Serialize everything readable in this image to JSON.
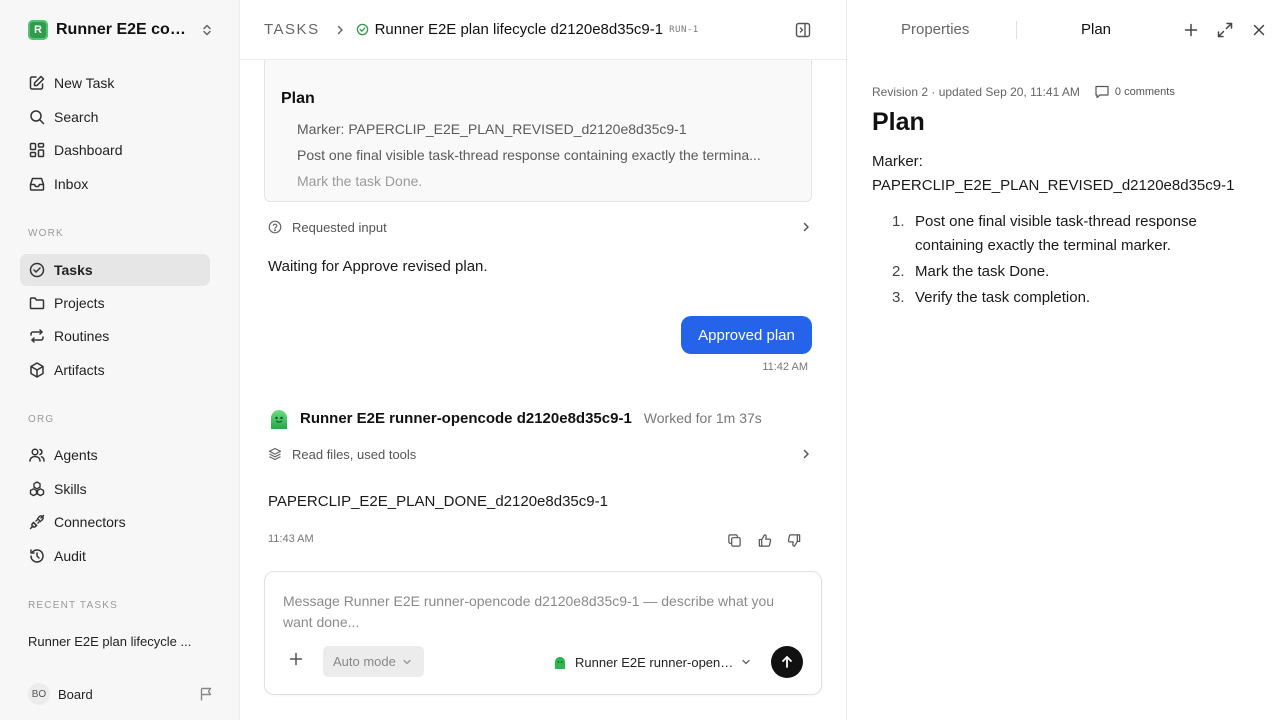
{
  "workspace": {
    "logo_letter": "R",
    "name": "Runner E2E core-..."
  },
  "nav": {
    "new_task": "New Task",
    "search": "Search",
    "dashboard": "Dashboard",
    "inbox": "Inbox",
    "work_label": "WORK",
    "tasks": "Tasks",
    "projects": "Projects",
    "routines": "Routines",
    "artifacts": "Artifacts",
    "org_label": "ORG",
    "agents": "Agents",
    "skills": "Skills",
    "connectors": "Connectors",
    "audit": "Audit",
    "recent_label": "RECENT TASKS",
    "recent_task": "Runner E2E plan lifecycle ..."
  },
  "user": {
    "initials": "BO",
    "name": "Board"
  },
  "header": {
    "breadcrumb_root": "TASKS",
    "task_title": "Runner E2E plan lifecycle d2120e8d35c9-1",
    "run_badge": "RUN-1"
  },
  "plan_card": {
    "title": "Plan",
    "items": [
      "Marker: PAPERCLIP_E2E_PLAN_REVISED_d2120e8d35c9-1",
      "Post one final visible task-thread response containing exactly the termina...",
      "Mark the task Done."
    ]
  },
  "thread": {
    "requested_input": "Requested input",
    "waiting_text": "Waiting for Approve revised plan.",
    "approved_label": "Approved plan",
    "approved_time": "11:42 AM",
    "agent_name": "Runner E2E runner-opencode d2120e8d35c9-1",
    "worked_for": "Worked for 1m 37s",
    "tools_summary": "Read files, used tools",
    "done_marker": "PAPERCLIP_E2E_PLAN_DONE_d2120e8d35c9-1",
    "done_time": "11:43 AM"
  },
  "composer": {
    "placeholder": "Message Runner E2E runner-opencode d2120e8d35c9-1 — describe what you want done...",
    "mode": "Auto mode",
    "agent": "Runner E2E runner-openc..."
  },
  "right_panel": {
    "tab_properties": "Properties",
    "tab_plan": "Plan",
    "meta": "Revision 2 · updated Sep 20, 11:41 AM",
    "comments": "0 comments",
    "title": "Plan",
    "marker_label": "Marker:",
    "marker_value": "PAPERCLIP_E2E_PLAN_REVISED_d2120e8d35c9-1",
    "steps": [
      {
        "num": "1.",
        "text": "Post one final visible task-thread response containing exactly the terminal marker."
      },
      {
        "num": "2.",
        "text": "Mark the task Done."
      },
      {
        "num": "3.",
        "text": "Verify the task completion."
      }
    ]
  },
  "colors": {
    "primary": "#2563eb",
    "status_green": "#2e9d4b",
    "send": "#111111"
  }
}
